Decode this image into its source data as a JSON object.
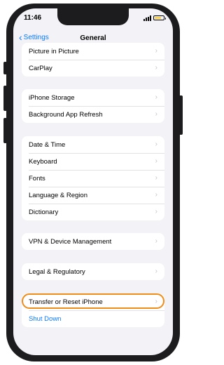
{
  "status": {
    "time": "11:46",
    "battery_level": 0.75
  },
  "navbar": {
    "back_label": "Settings",
    "title": "General"
  },
  "groups": [
    {
      "rows": [
        {
          "label": "Picture in Picture"
        },
        {
          "label": "CarPlay"
        }
      ]
    },
    {
      "rows": [
        {
          "label": "iPhone Storage"
        },
        {
          "label": "Background App Refresh"
        }
      ]
    },
    {
      "rows": [
        {
          "label": "Date & Time"
        },
        {
          "label": "Keyboard"
        },
        {
          "label": "Fonts"
        },
        {
          "label": "Language & Region"
        },
        {
          "label": "Dictionary"
        }
      ]
    },
    {
      "rows": [
        {
          "label": "VPN & Device Management"
        }
      ]
    },
    {
      "rows": [
        {
          "label": "Legal & Regulatory"
        }
      ]
    },
    {
      "rows": [
        {
          "label": "Transfer or Reset iPhone"
        },
        {
          "label": "Shut Down"
        }
      ]
    }
  ],
  "colors": {
    "accent": "#0a7aff",
    "highlight": "#f08c1a",
    "background": "#f2f2f7"
  },
  "icons": {
    "back": "chevron-left-icon",
    "row": "chevron-right-icon"
  }
}
